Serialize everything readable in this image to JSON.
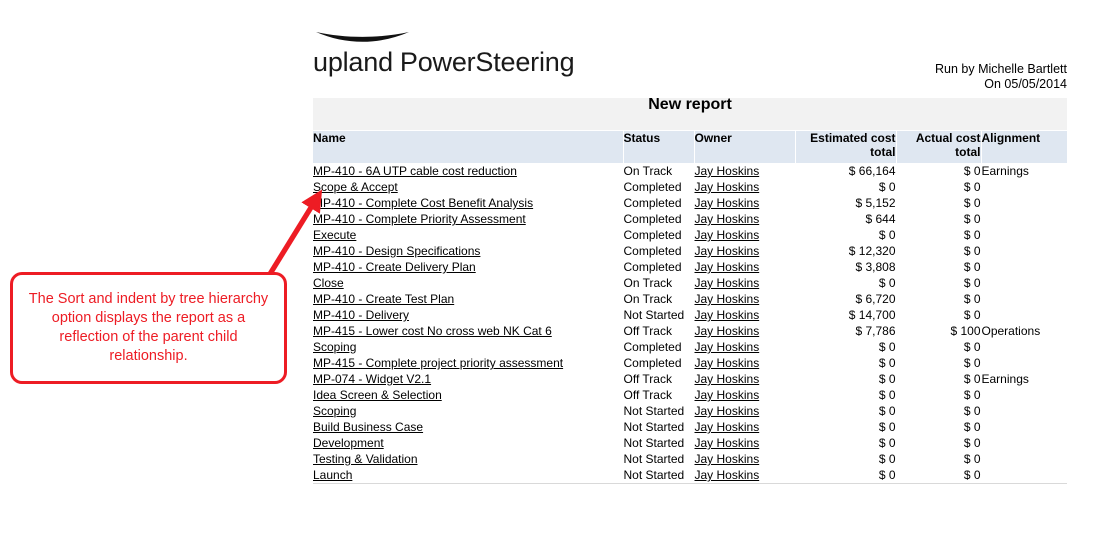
{
  "brand": {
    "logo_primary": "upland",
    "logo_secondary": "PowerSteering",
    "swoosh_icon": "upland-swoosh-icon",
    "accent_red": "#ed1c24",
    "header_blue": "#dfe7f1",
    "title_gray": "#f2f2f2"
  },
  "meta": {
    "run_by": "Run by Michelle Bartlett",
    "run_on": "On 05/05/2014"
  },
  "report": {
    "title": "New report",
    "columns": [
      {
        "label": "Name",
        "align": "left"
      },
      {
        "label": "Status",
        "align": "left"
      },
      {
        "label": "Owner",
        "align": "left"
      },
      {
        "label": "Estimated cost total",
        "align": "right"
      },
      {
        "label": "Actual cost total",
        "align": "right"
      },
      {
        "label": "Alignment",
        "align": "left"
      }
    ],
    "rows": [
      {
        "level": 0,
        "name": "MP-410 - 6A UTP cable cost reduction",
        "status": "On Track",
        "owner": "Jay Hoskins",
        "estimated_cost": "$ 66,164",
        "actual_cost": "$ 0",
        "alignment": "Earnings"
      },
      {
        "level": 1,
        "name": "Scope & Accept",
        "status": "Completed",
        "owner": "Jay Hoskins",
        "estimated_cost": "$ 0",
        "actual_cost": "$ 0",
        "alignment": ""
      },
      {
        "level": 2,
        "name": "MP-410 - Complete Cost Benefit Analysis",
        "status": "Completed",
        "owner": "Jay Hoskins",
        "estimated_cost": "$ 5,152",
        "actual_cost": "$ 0",
        "alignment": ""
      },
      {
        "level": 2,
        "name": "MP-410 - Complete Priority Assessment",
        "status": "Completed",
        "owner": "Jay Hoskins",
        "estimated_cost": "$ 644",
        "actual_cost": "$ 0",
        "alignment": ""
      },
      {
        "level": 1,
        "name": "Execute",
        "status": "Completed",
        "owner": "Jay Hoskins",
        "estimated_cost": "$ 0",
        "actual_cost": "$ 0",
        "alignment": ""
      },
      {
        "level": 2,
        "name": "MP-410 - Design Specifications",
        "status": "Completed",
        "owner": "Jay Hoskins",
        "estimated_cost": "$ 12,320",
        "actual_cost": "$ 0",
        "alignment": ""
      },
      {
        "level": 2,
        "name": "MP-410 - Create Delivery Plan",
        "status": "Completed",
        "owner": "Jay Hoskins",
        "estimated_cost": "$ 3,808",
        "actual_cost": "$ 0",
        "alignment": ""
      },
      {
        "level": 1,
        "name": "Close",
        "status": "On Track",
        "owner": "Jay Hoskins",
        "estimated_cost": "$ 0",
        "actual_cost": "$ 0",
        "alignment": ""
      },
      {
        "level": 2,
        "name": "MP-410 - Create Test Plan",
        "status": "On Track",
        "owner": "Jay Hoskins",
        "estimated_cost": "$ 6,720",
        "actual_cost": "$ 0",
        "alignment": ""
      },
      {
        "level": 2,
        "name": "MP-410 - Delivery",
        "status": "Not Started",
        "owner": "Jay Hoskins",
        "estimated_cost": "$ 14,700",
        "actual_cost": "$ 0",
        "alignment": ""
      },
      {
        "level": 0,
        "name": "MP-415 - Lower cost No cross web NK Cat 6",
        "status": "Off Track",
        "owner": "Jay Hoskins",
        "estimated_cost": "$ 7,786",
        "actual_cost": "$ 100",
        "alignment": "Operations"
      },
      {
        "level": 1,
        "name": "Scoping",
        "status": "Completed",
        "owner": "Jay Hoskins",
        "estimated_cost": "$ 0",
        "actual_cost": "$ 0",
        "alignment": ""
      },
      {
        "level": 2,
        "name": "MP-415 - Complete project priority assessment",
        "status": "Completed",
        "owner": "Jay Hoskins",
        "estimated_cost": "$ 0",
        "actual_cost": "$ 0",
        "alignment": "",
        "wrap": true
      },
      {
        "level": 0,
        "name": "MP-074 - Widget V2.1",
        "status": "Off Track",
        "owner": "Jay Hoskins",
        "estimated_cost": "$ 0",
        "actual_cost": "$ 0",
        "alignment": "Earnings"
      },
      {
        "level": 1,
        "name": "Idea Screen & Selection",
        "status": "Off Track",
        "owner": "Jay Hoskins",
        "estimated_cost": "$ 0",
        "actual_cost": "$ 0",
        "alignment": ""
      },
      {
        "level": 1,
        "name": "Scoping",
        "status": "Not Started",
        "owner": "Jay Hoskins",
        "estimated_cost": "$ 0",
        "actual_cost": "$ 0",
        "alignment": ""
      },
      {
        "level": 1,
        "name": "Build Business Case",
        "status": "Not Started",
        "owner": "Jay Hoskins",
        "estimated_cost": "$ 0",
        "actual_cost": "$ 0",
        "alignment": ""
      },
      {
        "level": 1,
        "name": "Development",
        "status": "Not Started",
        "owner": "Jay Hoskins",
        "estimated_cost": "$ 0",
        "actual_cost": "$ 0",
        "alignment": ""
      },
      {
        "level": 1,
        "name": "Testing & Validation",
        "status": "Not Started",
        "owner": "Jay Hoskins",
        "estimated_cost": "$ 0",
        "actual_cost": "$ 0",
        "alignment": ""
      },
      {
        "level": 1,
        "name": "Launch",
        "status": "Not Started",
        "owner": "Jay Hoskins",
        "estimated_cost": "$ 0",
        "actual_cost": "$ 0",
        "alignment": ""
      }
    ]
  },
  "annotation": {
    "text": "The Sort and indent by tree hierarchy option displays the report as a reflection of the parent child relationship.",
    "arrow_icon": "arrow-pointer-icon",
    "color": "#ed1c24"
  }
}
